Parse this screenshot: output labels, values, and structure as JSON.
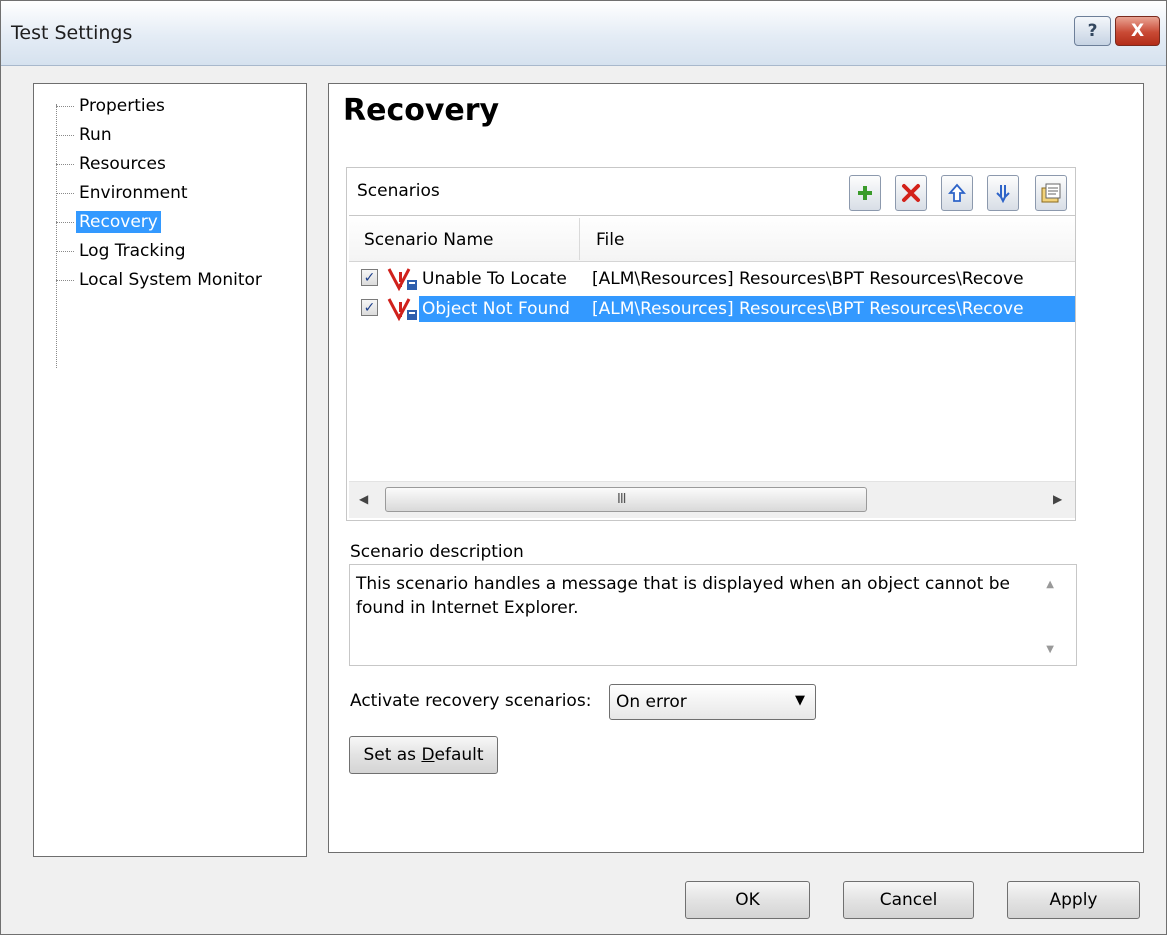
{
  "window": {
    "title": "Test Settings",
    "help_label": "?",
    "close_label": "X"
  },
  "nav": {
    "items": [
      {
        "label": "Properties",
        "selected": false
      },
      {
        "label": "Run",
        "selected": false
      },
      {
        "label": "Resources",
        "selected": false
      },
      {
        "label": "Environment",
        "selected": false
      },
      {
        "label": "Recovery",
        "selected": true
      },
      {
        "label": "Log Tracking",
        "selected": false
      },
      {
        "label": "Local System Monitor",
        "selected": false
      }
    ]
  },
  "recovery": {
    "title": "Recovery",
    "scenarios_label": "Scenarios",
    "toolbar": {
      "add_icon": "plus-icon",
      "delete_icon": "delete-x-icon",
      "up_icon": "arrow-up-icon",
      "down_icon": "arrow-down-icon",
      "properties_icon": "properties-icon"
    },
    "columns": [
      "Scenario Name",
      "File"
    ],
    "rows": [
      {
        "checked": true,
        "name": "Unable To Locate",
        "file": "[ALM\\Resources] Resources\\BPT Resources\\Recove",
        "selected": false
      },
      {
        "checked": true,
        "name": "Object Not Found",
        "file": "[ALM\\Resources] Resources\\BPT Resources\\Recove",
        "selected": true
      }
    ],
    "scroll_grip": "III",
    "description_label": "Scenario description",
    "description_text": "This scenario handles a message that is displayed when an object cannot be found in Internet Explorer.",
    "activate_label": "Activate recovery scenarios:",
    "activate_value": "On error",
    "set_default_label": "Set as Default",
    "set_default_mnemonic": "D"
  },
  "footer": {
    "ok_label": "OK",
    "cancel_label": "Cancel",
    "apply_label": "Apply"
  },
  "colors": {
    "selection": "#3399ff",
    "title_bar": "#e4ecf5",
    "close_button": "#c94a35"
  }
}
